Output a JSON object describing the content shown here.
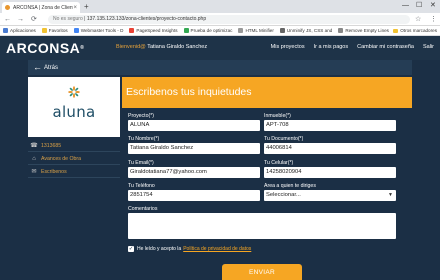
{
  "browser": {
    "tab_title": "ARCONSA | Zona de Clientes",
    "tab_close": "×",
    "new_tab": "+",
    "win_min": "—",
    "win_max": "☐",
    "win_close": "✕",
    "back": "←",
    "forward": "→",
    "reload": "⟳",
    "security": "No es seguro",
    "url": "137.135.123.133/zona-clientes/proyecto-contacto.php",
    "star": "☆",
    "menu": "⋮",
    "bookmarks": [
      {
        "label": "Aplicaciones",
        "color": "#4a7bd0"
      },
      {
        "label": "Favoritos",
        "color": "#f1c232"
      },
      {
        "label": "Webmaster Tools - D",
        "color": "#4285f4"
      },
      {
        "label": "PageSpeed Insights",
        "color": "#e94235"
      },
      {
        "label": "Prueba de optimizac",
        "color": "#34a853"
      },
      {
        "label": "HTML Minifier",
        "color": "#999999"
      },
      {
        "label": "Unminify JS, CSS and",
        "color": "#666666"
      },
      {
        "label": "Remove Empty Lines",
        "color": "#888888"
      }
    ],
    "other_bookmarks": "Otros marcadores"
  },
  "site": {
    "logo": "ARCONSA",
    "logo_mark": "®",
    "welcome_prefix": "Bienvenid@",
    "user_name": "Tatiana Giraldo Sanchez",
    "nav": [
      "Mis proyectos",
      "Ir a mis pagos",
      "Cambiar mi contraseña",
      "Salir"
    ]
  },
  "backbar": {
    "arrow": "←",
    "label": "Atrás"
  },
  "sidebar": {
    "brand": "aluna",
    "items": [
      {
        "icon": "☎",
        "label": "1313685"
      },
      {
        "icon": "⌂",
        "label": "Avances de Obra"
      },
      {
        "icon": "✉",
        "label": "Escribenos"
      }
    ]
  },
  "form": {
    "title": "Escribenos tus inquietudes",
    "fields": {
      "proyecto": {
        "label": "Proyecto(*)",
        "value": "ALUNA"
      },
      "inmueble": {
        "label": "Inmueble(*)",
        "value": "APT-708"
      },
      "nombre": {
        "label": "Tu Nombre(*)",
        "value": "Tatiana  Giraldo Sanchez"
      },
      "documento": {
        "label": "Tu Documento(*)",
        "value": "44006814"
      },
      "email": {
        "label": "Tu Email(*)",
        "value": "Giraldotatiana77@yahoo.com"
      },
      "celular": {
        "label": "Tu Celular(*)",
        "value": "14258020904"
      },
      "telefono": {
        "label": "Tu Teléfono",
        "value": "2851754"
      },
      "area": {
        "label": "Area a quien te diriges",
        "value": "Seleccionar..."
      },
      "comentarios": {
        "label": "Comentarios",
        "value": ""
      }
    },
    "consent_text": "He leído y acepto la",
    "consent_link": "Política de privacidad de datos",
    "checkbox_mark": "✓",
    "submit": "ENVIAR"
  },
  "colors": {
    "accent": "#f6a623",
    "header_bg": "#1e3348",
    "body_bg": "#1b2f45"
  }
}
